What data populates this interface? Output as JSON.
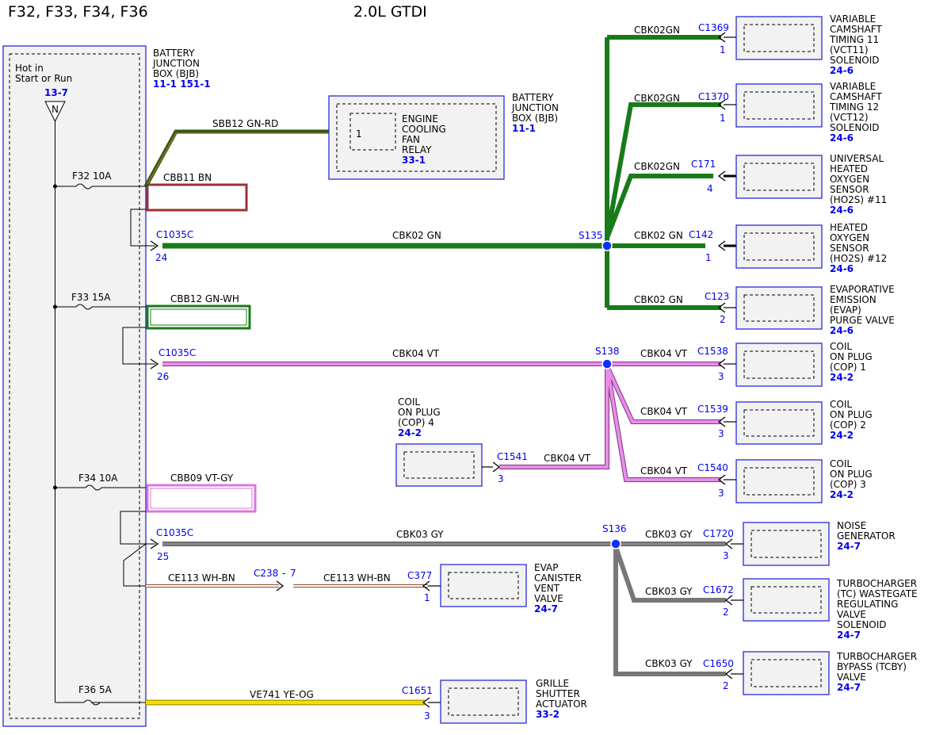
{
  "header": {
    "fuses_title": "F32, F33, F34, F36",
    "engine_title": "2.0L GTDI"
  },
  "bjb": {
    "power_label_1": "Hot in",
    "power_label_2": "Start or Run",
    "power_ref": "13-7",
    "node_label": "N",
    "name_lines": [
      "BATTERY",
      "JUNCTION",
      "BOX (BJB)"
    ],
    "refs": "11-1   151-1"
  },
  "fuses": [
    {
      "label": "F32  10A",
      "circuit": "CBB11    BN"
    },
    {
      "label": "F33  15A",
      "circuit": "CBB12    GN-WH"
    },
    {
      "label": "F34  10A",
      "circuit": "CBB09    VT-GY"
    },
    {
      "label": "F36  5A",
      "circuit": "VE741    YE-OG"
    }
  ],
  "relay": {
    "wire": "SBB12   GN-RD",
    "pin": "1",
    "name_lines": [
      "ENGINE",
      "COOLING",
      "FAN",
      "RELAY"
    ],
    "ref": "33-1",
    "bjb_lines": [
      "BATTERY",
      "JUNCTION",
      "BOX (BJB)"
    ],
    "bjb_ref": "11-1"
  },
  "trunks": [
    {
      "connector": "C1035C",
      "pin": "24",
      "wire": "CBK02   GN",
      "splice": "S135"
    },
    {
      "connector": "C1035C",
      "pin": "26",
      "wire": "CBK04   VT",
      "splice": "S138"
    },
    {
      "connector": "C1035C",
      "pin": "25",
      "wire": "CBK03 GY",
      "splice": "S136"
    }
  ],
  "components": [
    {
      "wire": "CBK02GN",
      "connector": "C1369",
      "pin": "1",
      "name_lines": [
        "VARIABLE",
        "CAMSHAFT",
        "TIMING 11",
        "(VCT11)",
        "SOLENOID"
      ],
      "ref": "24-6"
    },
    {
      "wire": "CBK02GN",
      "connector": "C1370",
      "pin": "1",
      "name_lines": [
        "VARIABLE",
        "CAMSHAFT",
        "TIMING 12",
        "(VCT12)",
        "SOLENOID"
      ],
      "ref": "24-6"
    },
    {
      "wire": "CBK02GN",
      "connector": "C171",
      "pin": "4",
      "name_lines": [
        "UNIVERSAL",
        "HEATED",
        "OXYGEN",
        "SENSOR",
        "(HO2S) #11"
      ],
      "ref": "24-6"
    },
    {
      "wire": "CBK02 GN",
      "connector": "C142",
      "pin": "1",
      "name_lines": [
        "HEATED",
        "OXYGEN",
        "SENSOR",
        "(HO2S) #12"
      ],
      "ref": "24-6"
    },
    {
      "wire": "CBK02  GN",
      "connector": "C123",
      "pin": "2",
      "name_lines": [
        "EVAPORATIVE",
        "EMISSION",
        "(EVAP)",
        "PURGE VALVE"
      ],
      "ref": "24-6"
    },
    {
      "wire": "CBK04 VT",
      "connector": "C1538",
      "pin": "3",
      "name_lines": [
        "COIL",
        "ON PLUG",
        "(COP) 1"
      ],
      "ref": "24-2"
    },
    {
      "wire": "CBK04 VT",
      "connector": "C1539",
      "pin": "3",
      "name_lines": [
        "COIL",
        "ON PLUG",
        "(COP) 2"
      ],
      "ref": "24-2"
    },
    {
      "wire": "CBK04 VT",
      "connector": "C1540",
      "pin": "3",
      "name_lines": [
        "COIL",
        "ON PLUG",
        "(COP) 3"
      ],
      "ref": "24-2"
    },
    {
      "wire": "CBK04 VT",
      "connector": "C1541",
      "pin": "3",
      "name_lines": [
        "COIL",
        "ON PLUG",
        "(COP) 4"
      ],
      "ref": "24-2"
    },
    {
      "wire": "CBK03  GY",
      "connector": "C1720",
      "pin": "3",
      "name_lines": [
        "NOISE",
        "GENERATOR"
      ],
      "ref": "24-7"
    },
    {
      "wire": "CBK03  GY",
      "connector": "C1672",
      "pin": "2",
      "name_lines": [
        "TURBOCHARGER",
        "(TC) WASTEGATE",
        "REGULATING",
        "VALVE",
        "SOLENOID"
      ],
      "ref": "24-7"
    },
    {
      "wire": "CBK03  GY",
      "connector": "C1650",
      "pin": "2",
      "name_lines": [
        "TURBOCHARGER",
        "BYPASS (TCBY)",
        "VALVE"
      ],
      "ref": "24-7"
    },
    {
      "wire": "CE113  WH-BN",
      "connector": "C377",
      "pin": "1",
      "name_lines": [
        "EVAP",
        "CANISTER",
        "VENT",
        "VALVE"
      ],
      "ref": "24-7"
    },
    {
      "wire": "VE741    YE-OG",
      "connector": "C1651",
      "pin": "3",
      "name_lines": [
        "GRILLE",
        "SHUTTER",
        "ACTUATOR"
      ],
      "ref": "33-2"
    }
  ],
  "inline": {
    "wire": "CE113  WH-BN",
    "connector": "C238",
    "sep": "-",
    "pin": "7"
  },
  "colors": {
    "green": "#1a7a1a",
    "brown": "#a03030",
    "violet": "#e98ce9",
    "gray": "#777777",
    "yellow": "#f2e000",
    "box_border": "#2b2bd6",
    "splice": "#1030ff",
    "blue_text": "#0000ee"
  }
}
